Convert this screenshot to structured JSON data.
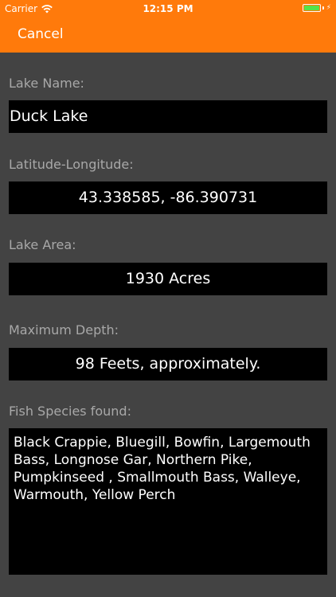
{
  "status_bar": {
    "carrier": "Carrier",
    "time": "12:15 PM",
    "battery_color": "#55e24a"
  },
  "nav": {
    "cancel_label": "Cancel",
    "accent_color": "#ff7a0b"
  },
  "fields": {
    "lake_name": {
      "label": "Lake Name:",
      "value": "Duck Lake"
    },
    "lat_long": {
      "label": "Latitude-Longitude:",
      "value": "43.338585, -86.390731"
    },
    "lake_area": {
      "label": "Lake Area:",
      "value": "1930 Acres"
    },
    "max_depth": {
      "label": "Maximum Depth:",
      "value": "98 Feets, approximately."
    },
    "fish_species": {
      "label": "Fish Species found:",
      "value": "Black Crappie, Bluegill, Bowfin, Largemouth Bass, Longnose Gar, Northern Pike, Pumpkinseed , Smallmouth Bass, Walleye, Warmouth, Yellow Perch"
    }
  }
}
